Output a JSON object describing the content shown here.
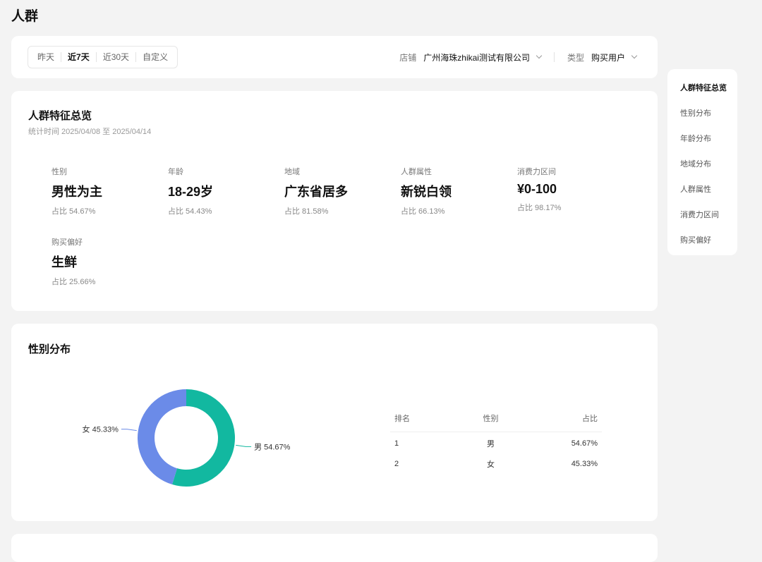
{
  "page": {
    "title": "人群"
  },
  "filters": {
    "ranges": [
      "昨天",
      "近7天",
      "近30天",
      "自定义"
    ],
    "active_range": "近7天",
    "store": {
      "label": "店铺",
      "value": "广州海珠zhikai测试有限公司"
    },
    "type": {
      "label": "类型",
      "value": "购买用户"
    }
  },
  "overview": {
    "title": "人群特征总览",
    "subtitle": "统计时间 2025/04/08 至 2025/04/14",
    "stats": [
      {
        "label": "性别",
        "value": "男性为主",
        "pct": "占比 54.67%"
      },
      {
        "label": "年龄",
        "value": "18-29岁",
        "pct": "占比 54.43%"
      },
      {
        "label": "地域",
        "value": "广东省居多",
        "pct": "占比 81.58%"
      },
      {
        "label": "人群属性",
        "value": "新锐白领",
        "pct": "占比 66.13%"
      },
      {
        "label": "消费力区间",
        "value": "¥0-100",
        "pct": "占比 98.17%"
      },
      {
        "label": "购买偏好",
        "value": "生鲜",
        "pct": "占比 25.66%"
      }
    ]
  },
  "gender": {
    "title": "性别分布",
    "chart_data": {
      "type": "pie",
      "categories": [
        "男",
        "女"
      ],
      "values": [
        54.67,
        45.33
      ],
      "labels": [
        "男 54.67%",
        "女 45.33%"
      ],
      "colors": [
        "#12b8a0",
        "#6b8be8"
      ]
    },
    "table": {
      "headers": [
        "排名",
        "性别",
        "占比"
      ],
      "rows": [
        [
          "1",
          "男",
          "54.67%"
        ],
        [
          "2",
          "女",
          "45.33%"
        ]
      ]
    }
  },
  "side_nav": {
    "items": [
      "人群特征总览",
      "性别分布",
      "年龄分布",
      "地域分布",
      "人群属性",
      "消费力区间",
      "购买偏好"
    ],
    "active": "人群特征总览"
  }
}
